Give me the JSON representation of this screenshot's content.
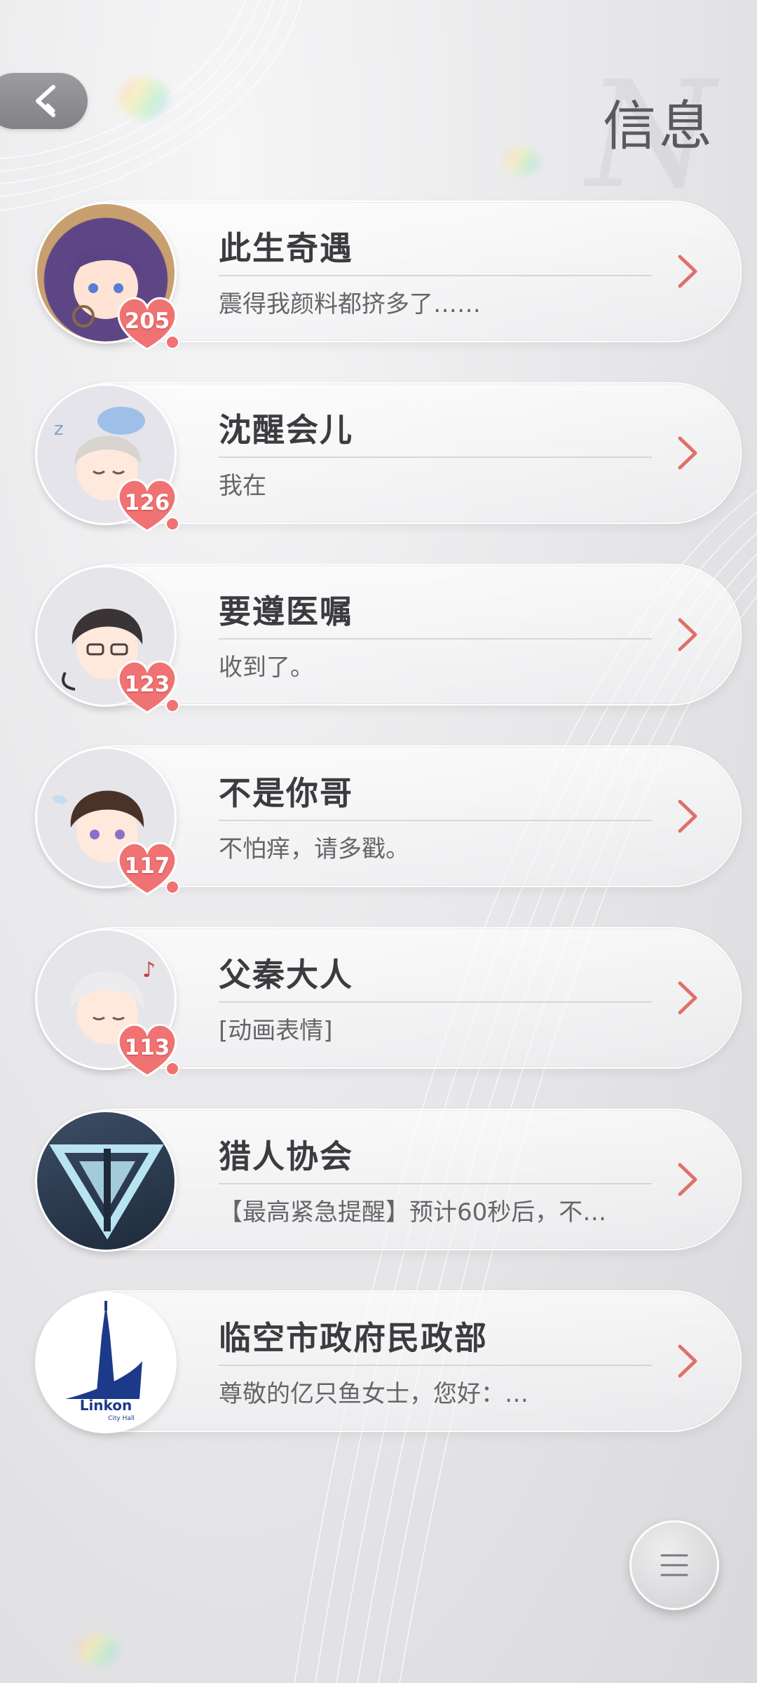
{
  "header": {
    "title": "信息",
    "back_icon": "chevron-left-icon"
  },
  "contacts": [
    {
      "name": "此生奇遇",
      "preview": "震得我颜料都挤多了……",
      "affection": "205",
      "avatar": "purple-hair-painter"
    },
    {
      "name": "沈醒会儿",
      "preview": "我在",
      "affection": "126",
      "avatar": "sleepy-white-hair"
    },
    {
      "name": "要遵医嘱",
      "preview": "收到了。",
      "affection": "123",
      "avatar": "black-hair-doctor"
    },
    {
      "name": "不是你哥",
      "preview": "不怕痒，请多戳。",
      "affection": "117",
      "avatar": "brown-hair-boy"
    },
    {
      "name": "父秦大人",
      "preview": "[动画表情]",
      "affection": "113",
      "avatar": "silver-hair-singer"
    },
    {
      "name": "猎人协会",
      "preview": "【最高紧急提醒】预计60秒后，不…",
      "affection": null,
      "avatar": "hunter-association-logo"
    },
    {
      "name": "临空市政府民政部",
      "preview": "尊敬的亿只鱼女士，您好：…",
      "affection": null,
      "avatar": "linkon-city-hall-logo",
      "logo_text": "Linkon",
      "logo_subtext": "City Hall"
    }
  ],
  "menu": {
    "icon": "menu-icon"
  },
  "colors": {
    "accent": "#e0706a",
    "heart": "#f07272"
  }
}
